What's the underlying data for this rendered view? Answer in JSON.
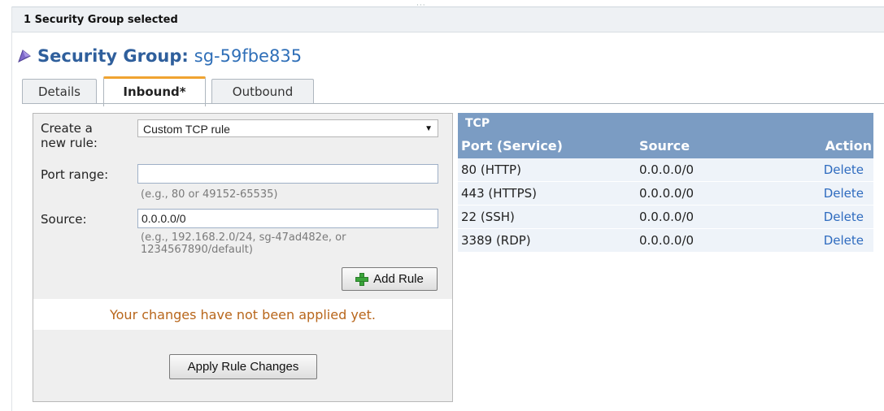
{
  "panel": {
    "header": "1 Security Group selected"
  },
  "title": {
    "label": "Security Group:",
    "value": "sg-59fbe835"
  },
  "tabs": [
    {
      "label": "Details",
      "active": false
    },
    {
      "label": "Inbound*",
      "active": true
    },
    {
      "label": "Outbound",
      "active": false
    }
  ],
  "form": {
    "create_label": "Create a\nnew rule:",
    "rule_type": "Custom TCP rule",
    "port_label": "Port range:",
    "port_value": "",
    "port_hint": "(e.g., 80 or 49152-65535)",
    "source_label": "Source:",
    "source_value": "0.0.0.0/0",
    "source_hint": "(e.g., 192.168.2.0/24, sg-47ad482e, or\n1234567890/default)",
    "add_button": "Add Rule",
    "notice": "Your changes have not been applied yet.",
    "apply_button": "Apply Rule Changes"
  },
  "rules_table": {
    "protocol": "TCP",
    "headers": {
      "port": "Port (Service)",
      "source": "Source",
      "action": "Action"
    },
    "rows": [
      {
        "port": "80 (HTTP)",
        "source": "0.0.0.0/0",
        "action": "Delete"
      },
      {
        "port": "443 (HTTPS)",
        "source": "0.0.0.0/0",
        "action": "Delete"
      },
      {
        "port": "22 (SSH)",
        "source": "0.0.0.0/0",
        "action": "Delete"
      },
      {
        "port": "3389 (RDP)",
        "source": "0.0.0.0/0",
        "action": "Delete"
      }
    ]
  },
  "colors": {
    "title_blue": "#2f5f9c",
    "table_header": "#7b9cc3",
    "tab_accent": "#f0a431",
    "notice": "#b8661b",
    "link": "#2e6bbf"
  },
  "icons": [
    "security-group-icon",
    "add-icon",
    "dropdown-caret-icon"
  ]
}
